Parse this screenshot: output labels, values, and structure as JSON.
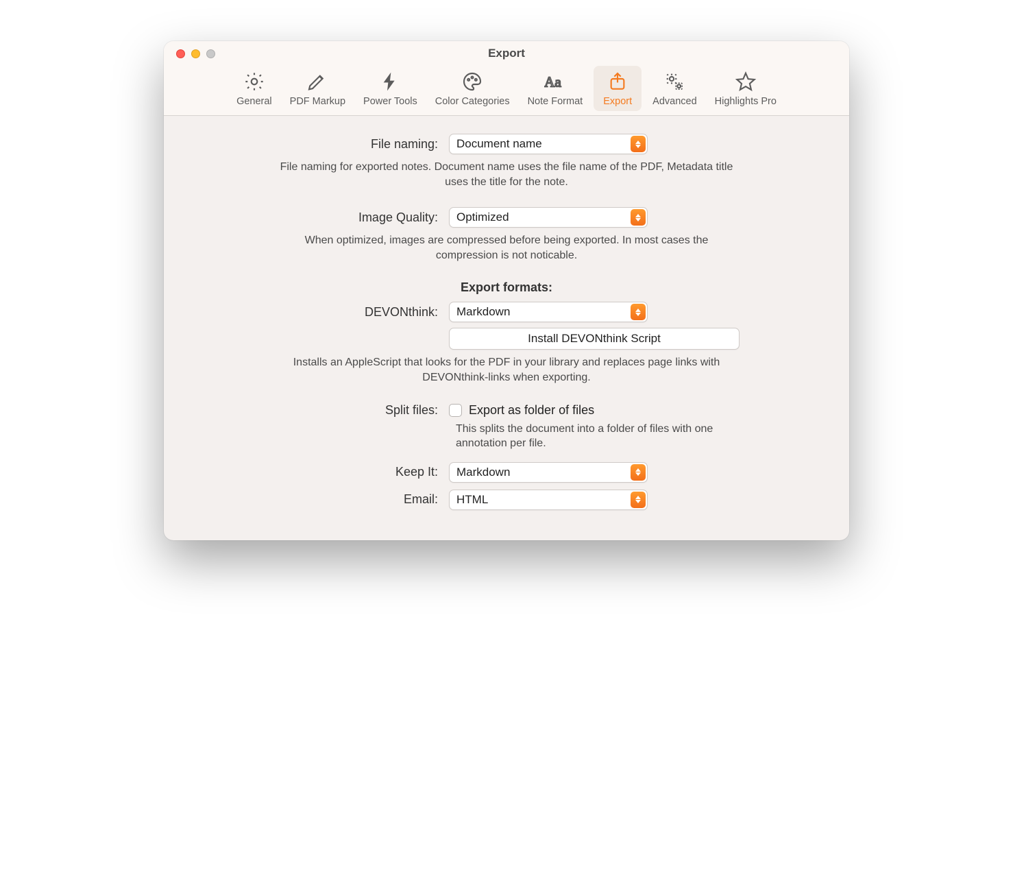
{
  "window": {
    "title": "Export"
  },
  "tabs": {
    "general": "General",
    "pdf_markup": "PDF Markup",
    "power_tools": "Power Tools",
    "color_categories": "Color Categories",
    "note_format": "Note Format",
    "export": "Export",
    "advanced": "Advanced",
    "highlights_pro": "Highlights Pro"
  },
  "fields": {
    "file_naming": {
      "label": "File naming:",
      "value": "Document name",
      "help": "File naming for exported notes. Document name uses the file name of the PDF, Metadata title uses the title for the note."
    },
    "image_quality": {
      "label": "Image Quality:",
      "value": "Optimized",
      "help": "When optimized, images are compressed before being exported. In most cases the compression is not noticable."
    },
    "export_formats_title": "Export formats:",
    "devonthink": {
      "label": "DEVONthink:",
      "value": "Markdown",
      "install_button": "Install DEVONthink Script",
      "install_help": "Installs an AppleScript that looks for the PDF in your library and replaces page links with DEVONthink-links when exporting."
    },
    "split_files": {
      "label": "Split files:",
      "checkbox_label": "Export as folder of files",
      "help": "This splits the document into a folder of files with one annotation per file."
    },
    "keep_it": {
      "label": "Keep It:",
      "value": "Markdown"
    },
    "email": {
      "label": "Email:",
      "value": "HTML"
    }
  }
}
